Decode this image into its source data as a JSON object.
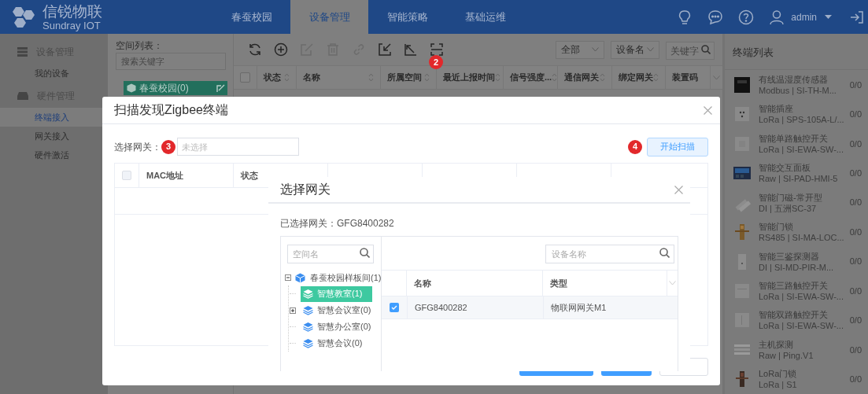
{
  "header": {
    "brand": "信锐物联",
    "brand_sub": "Sundray IOT",
    "user": "admin",
    "nav": [
      {
        "label": "春蚕校园",
        "selected": false
      },
      {
        "label": "设备管理",
        "selected": true
      },
      {
        "label": "智能策略",
        "selected": false
      },
      {
        "label": "基础运维",
        "selected": false
      }
    ]
  },
  "sidebar": {
    "groups": [
      {
        "label": "设备管理",
        "kind": "list",
        "items": [
          {
            "label": "我的设备",
            "selected": false
          }
        ]
      },
      {
        "label": "硬件管理",
        "kind": "drive",
        "items": [
          {
            "label": "终端接入",
            "selected": true
          },
          {
            "label": "网关接入",
            "selected": false
          },
          {
            "label": "硬件激活",
            "selected": false
          }
        ]
      }
    ]
  },
  "space_list": {
    "title": "空间列表：",
    "search_placeholder": "搜索关键字",
    "tree": [
      {
        "label": "春蚕校园(0)",
        "selected": true
      }
    ]
  },
  "main": {
    "toolbar": [
      {
        "kind": "refresh",
        "disabled": false
      },
      {
        "kind": "add",
        "disabled": false
      },
      {
        "kind": "edit",
        "disabled": true
      },
      {
        "kind": "delete",
        "disabled": true
      },
      {
        "kind": "link",
        "disabled": true
      },
      {
        "kind": "import",
        "disabled": false
      },
      {
        "kind": "export",
        "disabled": false
      },
      {
        "kind": "scan",
        "disabled": false
      }
    ],
    "toolbar_badge": "2",
    "select_all_checked": false,
    "filters": [
      {
        "kind": "select",
        "value": "全部"
      },
      {
        "kind": "select",
        "value": "设备名"
      },
      {
        "kind": "search",
        "placeholder": "关键字"
      }
    ],
    "columns": [
      "状态",
      "名称",
      "所属空间",
      "最近上报时间",
      "信号强度...",
      "通信网关",
      "绑定网关",
      "装置码"
    ]
  },
  "terminal_list": {
    "title": "终端列表",
    "items": [
      {
        "name": "有线温湿度传感器",
        "detail": "Modbus | SI-TH-M...",
        "count": "0/0"
      },
      {
        "name": "智能插座",
        "detail": "LoRa | SPS-105A-L/...",
        "count": "0/0"
      },
      {
        "name": "智能单路触控开关",
        "detail": "LoRa | SI-EWA-SW-...",
        "count": "0/0"
      },
      {
        "name": "智能交互面板",
        "detail": "Raw | SI-PAD-HMI-5",
        "count": "0/0"
      },
      {
        "name": "智能门磁-常开型",
        "detail": "DI | 五洲SC-37",
        "count": "0/0"
      },
      {
        "name": "智能门锁",
        "detail": "RS485 | SI-MA-LOC...",
        "count": "0/0"
      },
      {
        "name": "智能三鉴探测器",
        "detail": "DI | SI-MD-PIR-M...",
        "count": "0/0"
      },
      {
        "name": "智能三路触控开关",
        "detail": "LoRa | SI-EWA-SW-...",
        "count": "0/0"
      },
      {
        "name": "智能双路触控开关",
        "detail": "LoRa | SI-EWA-SW-...",
        "count": "0/0"
      },
      {
        "name": "主机探测",
        "detail": "Raw | Ping.V1",
        "count": "0/0"
      },
      {
        "name": "LoRa门锁",
        "detail": "LoRa | S1",
        "count": "0/0"
      }
    ]
  },
  "scan_dialog": {
    "title": "扫描发现Zigbee终端",
    "gateway_label": "选择网关：",
    "gateway_badge": "3",
    "gateway_placeholder": "未选择",
    "scan_badge": "4",
    "scan_button": "开始扫描",
    "select_all_checked": false,
    "columns": [
      "MAC地址",
      "状态"
    ]
  },
  "gateway_dialog": {
    "title": "选择网关",
    "selected_text": "已选择网关：GFG8400282",
    "tree_search_placeholder": "空间名",
    "device_search_placeholder": "设备名称",
    "tree": [
      {
        "label": "春蚕校园样板间(1)",
        "kind": "group",
        "expanded": true,
        "selected": false,
        "children": [
          {
            "label": "智慧教室(1)",
            "kind": "leaf",
            "selected": true
          },
          {
            "label": "智慧会议室(0)",
            "kind": "group",
            "expanded": false,
            "selected": false
          },
          {
            "label": "智慧办公室(0)",
            "kind": "leaf",
            "selected": false
          },
          {
            "label": "智慧会议(0)",
            "kind": "leaf",
            "selected": false
          }
        ]
      }
    ],
    "columns": [
      "名称",
      "类型"
    ],
    "rows": [
      {
        "checked": true,
        "cells": [
          "GFG8400282",
          "物联网网关M1"
        ]
      }
    ]
  }
}
